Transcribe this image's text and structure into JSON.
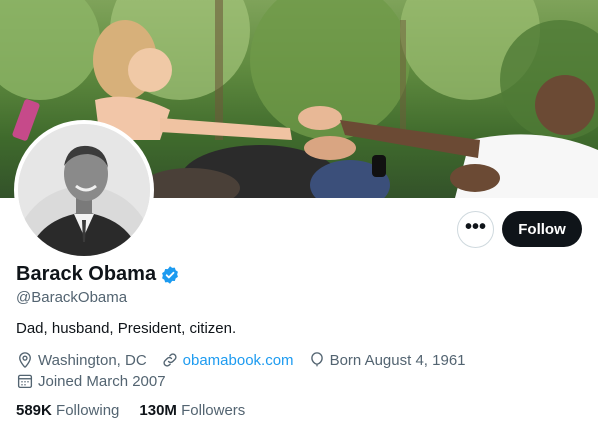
{
  "profile": {
    "display_name": "Barack Obama",
    "handle": "@BarackObama",
    "bio": "Dad, husband, President, citizen.",
    "location": "Washington, DC",
    "website": "obamabook.com",
    "birthday": "Born August 4, 1961",
    "joined": "Joined March 2007",
    "verified": true
  },
  "actions": {
    "more_label": "•••",
    "follow_label": "Follow"
  },
  "stats": {
    "following_count": "589K",
    "following_label": "Following",
    "followers_count": "130M",
    "followers_label": "Followers"
  },
  "icons": {
    "verified": "verified-badge-icon",
    "location": "location-pin-icon",
    "link": "link-icon",
    "birthday": "balloon-icon",
    "joined": "calendar-icon"
  },
  "colors": {
    "accent": "#1d9bf0",
    "primary_text": "#0f1419",
    "secondary_text": "#536471",
    "follow_bg": "#0f1419"
  }
}
